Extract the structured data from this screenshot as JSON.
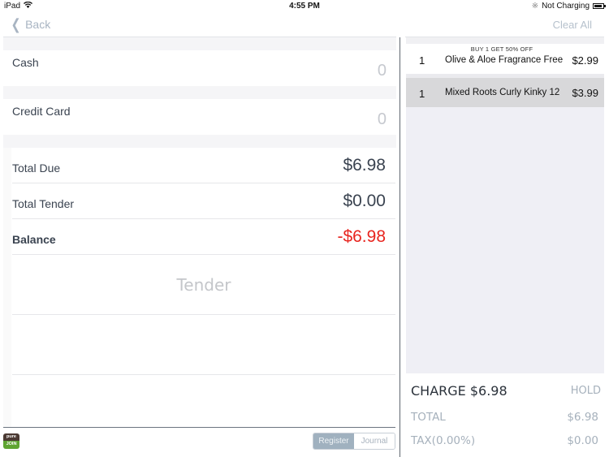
{
  "status_bar": {
    "device": "iPad",
    "wifi_icon": "wifi-icon",
    "time": "4:55 PM",
    "bluetooth_icon": "bluetooth-icon",
    "charging": "Not Charging",
    "battery_icon": "battery-icon"
  },
  "nav": {
    "back_label": "Back",
    "back_icon": "chevron-left-icon",
    "clear_all_label": "Clear All"
  },
  "payments": [
    {
      "label": "Cash",
      "value": "0"
    },
    {
      "label": "Credit Card",
      "value": "0"
    }
  ],
  "summary": {
    "total_due_label": "Total Due",
    "total_due_value": "$6.98",
    "total_tender_label": "Total Tender",
    "total_tender_value": "$0.00",
    "balance_label": "Balance",
    "balance_value": "-$6.98",
    "balance_color": "#e8251f"
  },
  "tender_label": "Tender",
  "logo": {
    "top": "pure",
    "bottom": "JOIN"
  },
  "segmented": {
    "options": [
      "Register",
      "Journal"
    ],
    "selected": "Register"
  },
  "cart": {
    "items": [
      {
        "qty": "1",
        "name": "Olive & Aloe Fragrance Free",
        "price": "$2.99",
        "promo": "BUY 1 GET 50% OFF",
        "selected": false
      },
      {
        "qty": "1",
        "name": "Mixed Roots Curly Kinky 12",
        "price": "$3.99",
        "promo": "",
        "selected": true
      }
    ]
  },
  "totals": {
    "charge_label": "CHARGE $6.98",
    "hold_label": "HOLD",
    "total_label": "TOTAL",
    "total_value": "$6.98",
    "tax_label": "TAX(0.00%)",
    "tax_value": "$0.00"
  }
}
